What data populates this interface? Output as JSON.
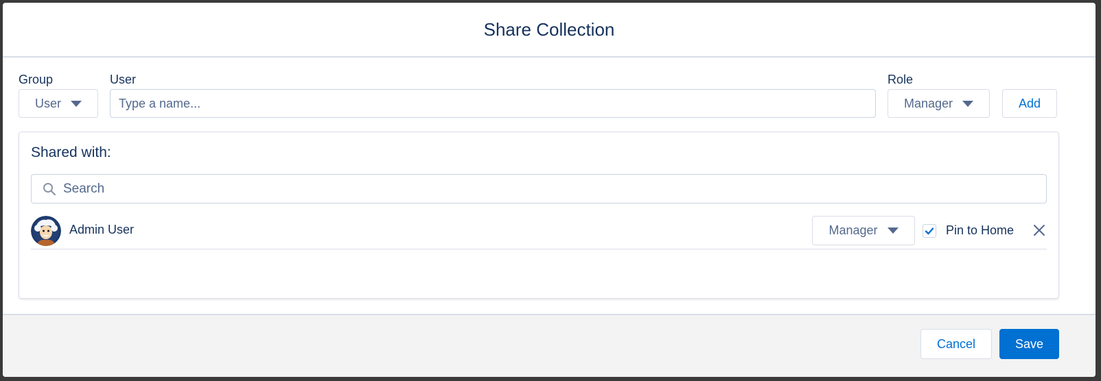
{
  "modal": {
    "title": "Share Collection"
  },
  "form": {
    "group_label": "Group",
    "group_value": "User",
    "user_label": "User",
    "user_placeholder": "Type a name...",
    "role_label": "Role",
    "role_value": "Manager",
    "add_label": "Add"
  },
  "shared": {
    "title": "Shared with:",
    "search_placeholder": "Search",
    "users": [
      {
        "name": "Admin User",
        "role": "Manager",
        "pin_label": "Pin to Home",
        "pinned": true,
        "avatar_icon": "einstein-avatar-icon"
      }
    ]
  },
  "footer": {
    "cancel_label": "Cancel",
    "save_label": "Save"
  },
  "colors": {
    "brand": "#0070d2",
    "text": "#16325c",
    "muted": "#54698d",
    "border": "#d8dde6"
  }
}
